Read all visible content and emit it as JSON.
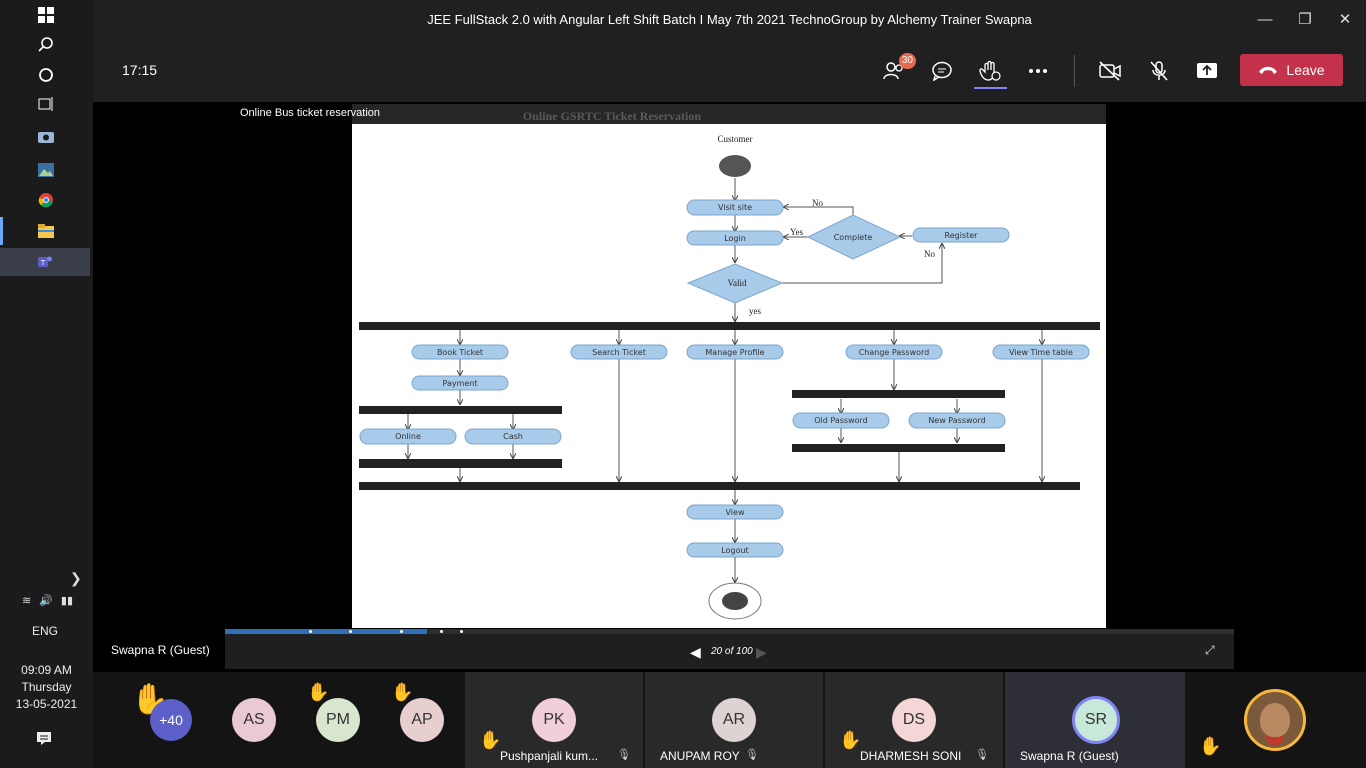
{
  "taskbar": {
    "icons": [
      "windows-start-icon",
      "search-icon",
      "cortana-icon",
      "task-view-icon",
      "camera-app-icon",
      "photos-app-icon",
      "chrome-icon",
      "file-explorer-icon",
      "teams-icon"
    ],
    "language": "ENG",
    "time": "09:09 AM",
    "day": "Thursday",
    "date": "13-05-2021"
  },
  "window": {
    "title": "JEE FullStack 2.0 with Angular Left Shift Batch I May 7th 2021 TechnoGroup by Alchemy Trainer Swapna"
  },
  "toolbar": {
    "timer": "17:15",
    "participants_count": "30",
    "leave_label": "Leave",
    "accent": "#c4314b"
  },
  "stage": {
    "share_label": "Online Bus ticket reservation",
    "slide_faded_title": "Online GSRTC Ticket Reservation",
    "presenter": "Swapna R (Guest)",
    "pager": "20 of 100",
    "progress_fraction": 0.2
  },
  "diagram": {
    "customer": "Customer",
    "visit_site": "Visit site",
    "login": "Login",
    "complete": "Complete",
    "register": "Register",
    "valid": "Valid",
    "no1": "No",
    "yes1": "Yes",
    "no2": "No",
    "yes2": "yes",
    "book_ticket": "Book Ticket",
    "payment": "Payment",
    "online": "Online",
    "cash": "Cash",
    "search_ticket": "Search Ticket",
    "manage_profile": "Manage Profile",
    "change_password": "Change Password",
    "old_password": "Old Password",
    "new_password": "New Password",
    "view_timetable": "View Time table",
    "view": "View",
    "logout": "Logout"
  },
  "participants": {
    "more": "+40",
    "tiles": [
      {
        "initials": "AS",
        "color": "#e9c9d6"
      },
      {
        "initials": "PM",
        "color": "#d8e6cf"
      },
      {
        "initials": "AP",
        "color": "#e7cfcf"
      },
      {
        "initials": "PK",
        "name": "Pushpanjali kum...",
        "color": "#f1cfd8"
      },
      {
        "initials": "AR",
        "name": "ANUPAM ROY",
        "color": "#ddd3d3"
      },
      {
        "initials": "DS",
        "name": "DHARMESH SONI",
        "color": "#f4d6d6"
      },
      {
        "initials": "SR",
        "name": "Swapna R (Guest)",
        "color": "#c8e8da"
      }
    ]
  }
}
